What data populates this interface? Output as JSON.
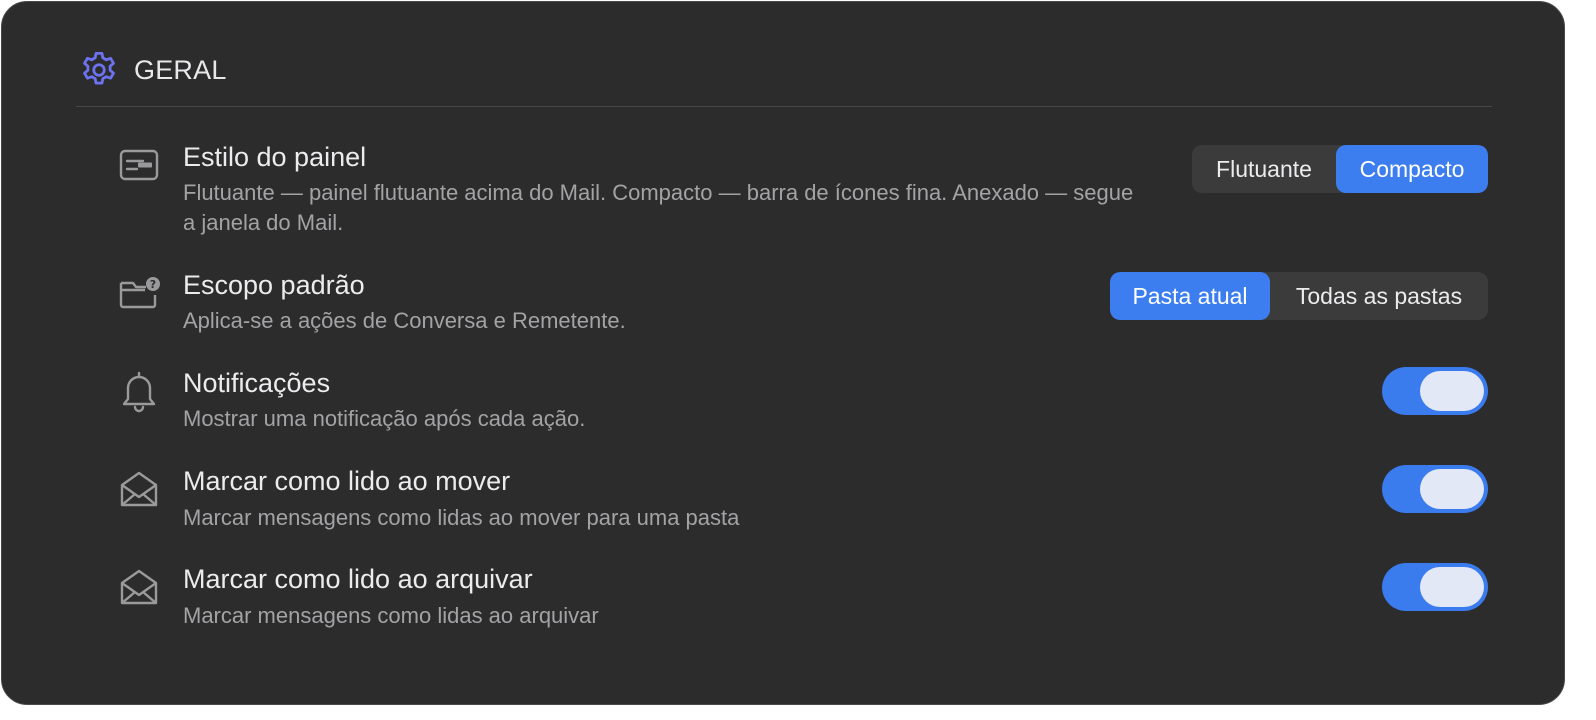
{
  "section": {
    "title": "GERAL",
    "icon": "gear-icon",
    "accent": "#6c72f0"
  },
  "settings": {
    "panel_style": {
      "icon": "panel-layout-icon",
      "title": "Estilo do painel",
      "description": "Flutuante — painel flutuante acima do Mail. Compacto — barra de ícones fina. Anexado — segue a janela do Mail.",
      "options": [
        "Flutuante",
        "Compacto"
      ],
      "selected": "Compacto"
    },
    "default_scope": {
      "icon": "folder-question-icon",
      "title": "Escopo padrão",
      "description": "Aplica-se a ações de Conversa e Remetente.",
      "options": [
        "Pasta atual",
        "Todas as pastas"
      ],
      "selected": "Pasta atual"
    },
    "notifications": {
      "icon": "bell-icon",
      "title": "Notificações",
      "description": "Mostrar uma notificação após cada ação.",
      "enabled": true
    },
    "mark_read_on_move": {
      "icon": "open-envelope-icon",
      "title": "Marcar como lido ao mover",
      "description": "Marcar mensagens como lidas ao mover para uma pasta",
      "enabled": true
    },
    "mark_read_on_archive": {
      "icon": "open-envelope-icon",
      "title": "Marcar como lido ao arquivar",
      "description": "Marcar mensagens como lidas ao arquivar",
      "enabled": true
    }
  },
  "colors": {
    "background": "#2c2c2c",
    "toggle_on": "#3a7bee",
    "segment_active": "#3c7ef0",
    "text_primary": "#ececee",
    "text_secondary": "#a3a3a6"
  }
}
